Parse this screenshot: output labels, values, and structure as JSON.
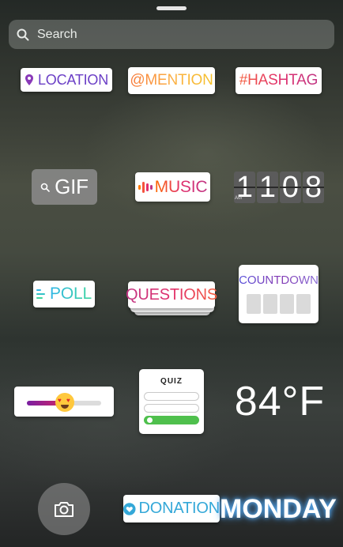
{
  "search": {
    "placeholder": "Search",
    "icon": "search-icon"
  },
  "stickers": {
    "location": "LOCATION",
    "mention": "@MENTION",
    "hashtag": "#HASHTAG",
    "gif": "GIF",
    "music": "MUSIC",
    "time": {
      "digits": [
        "1",
        "1",
        "0",
        "8"
      ],
      "period": "AM"
    },
    "poll": "POLL",
    "questions": "QUESTIONS",
    "countdown": "COUNTDOWN",
    "slider": {
      "emoji": "heart-eyes-emoji",
      "level": 0.55
    },
    "quiz": {
      "title": "QUIZ",
      "correct_option": 3
    },
    "temperature": "84°F",
    "donation": "DONATION",
    "weekday": "MONDAY"
  },
  "colors": {
    "location": "#6b3fc6",
    "music": "#e1306c",
    "poll": "#2fb5e6",
    "donation": "#34a8d8",
    "quiz_correct": "#4fc04d",
    "monday_glow": "#5fb8ff"
  }
}
